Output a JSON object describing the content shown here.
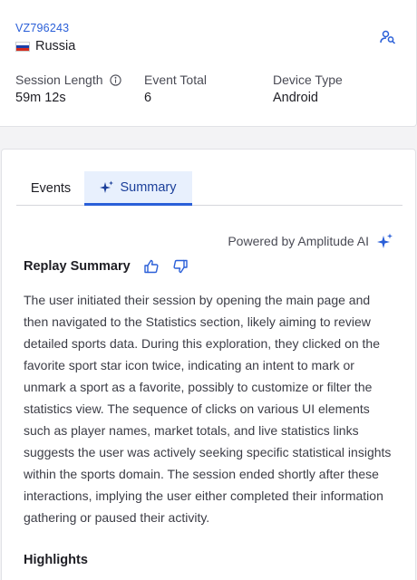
{
  "session": {
    "user_id": "VZ796243",
    "country": "Russia",
    "flag_colors": [
      "#ffffff",
      "#1c3fa8",
      "#d52b1e"
    ]
  },
  "stats": [
    {
      "label": "Session Length",
      "value": "59m 12s",
      "has_info": true
    },
    {
      "label": "Event Total",
      "value": "6",
      "has_info": false
    },
    {
      "label": "Device Type",
      "value": "Android",
      "has_info": false
    }
  ],
  "tabs": [
    {
      "label": "Events",
      "active": false
    },
    {
      "label": "Summary",
      "active": true,
      "icon": "sparkle-icon"
    }
  ],
  "ai": {
    "powered_by": "Powered by Amplitude AI",
    "icon": "ai-sparkle-icon"
  },
  "replay": {
    "title": "Replay Summary",
    "summary": "The user initiated their session by opening the main page and then navigated to the Statistics section, likely aiming to review detailed sports data. During this exploration, they clicked on the favorite sport star icon twice, indicating an intent to mark or unmark a sport as a favorite, possibly to customize or filter the statistics view. The sequence of clicks on various UI elements such as player names, market totals, and live statistics links suggests the user was actively seeking specific statistical insights within the sports domain. The session ended shortly after these interactions, implying the user either completed their information gathering or paused their activity."
  },
  "highlights": {
    "title": "Highlights"
  },
  "colors": {
    "accent": "#2a5fd8",
    "tab_active_bg": "#e8f0fd",
    "link": "#2a5fd8"
  }
}
